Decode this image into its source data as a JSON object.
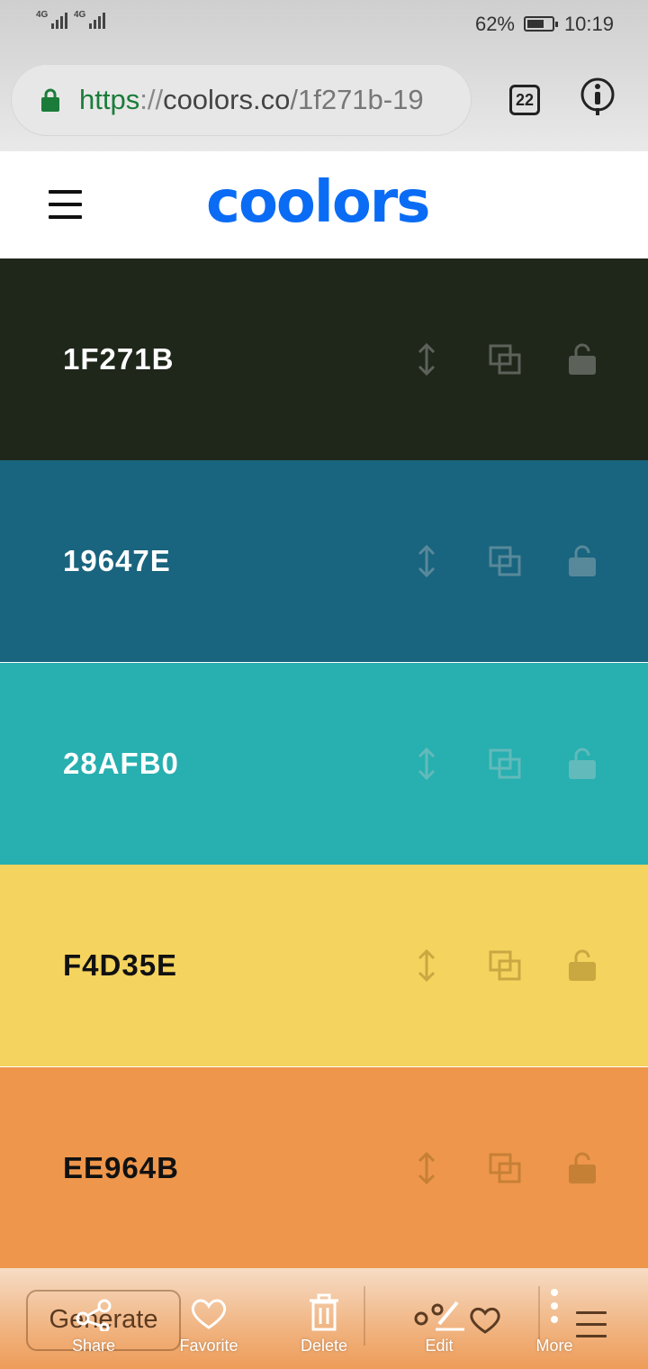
{
  "status_bar": {
    "battery_percent": "62%",
    "time": "10:19",
    "network_1": "4G",
    "network_2": "4G"
  },
  "browser": {
    "url_scheme": "https",
    "url_separator": "://",
    "url_host": "coolors.co",
    "url_path": "/1f271b-19",
    "tab_count": "22"
  },
  "app": {
    "logo_text": "coolors"
  },
  "swatches": [
    {
      "hex": "1F271B",
      "bg": "#1f271b",
      "fg": "#ffffff"
    },
    {
      "hex": "19647E",
      "bg": "#19647e",
      "fg": "#ffffff"
    },
    {
      "hex": "28AFB0",
      "bg": "#28afb0",
      "fg": "#ffffff"
    },
    {
      "hex": "F4D35E",
      "bg": "#f4d35e",
      "fg": "#111111"
    },
    {
      "hex": "EE964B",
      "bg": "#ee964b",
      "fg": "#111111"
    }
  ],
  "toolbar": {
    "generate_label": "Generate",
    "share_label": "Share",
    "favorite_label": "Favorite",
    "delete_label": "Delete",
    "edit_label": "Edit",
    "more_label": "More"
  },
  "icons": {
    "lock": "lock-icon",
    "tabs": "tabs-icon",
    "info": "info-icon",
    "menu": "hamburger-icon",
    "move": "drag-vertical-icon",
    "copy": "copy-icon",
    "unlock": "unlock-icon",
    "share": "share-icon",
    "favorite": "heart-icon",
    "delete": "trash-icon",
    "edit": "pencil-icon",
    "more": "more-vertical-icon"
  },
  "colors": {
    "brand": "#0a6cf5",
    "secure": "#1b7c3a"
  }
}
